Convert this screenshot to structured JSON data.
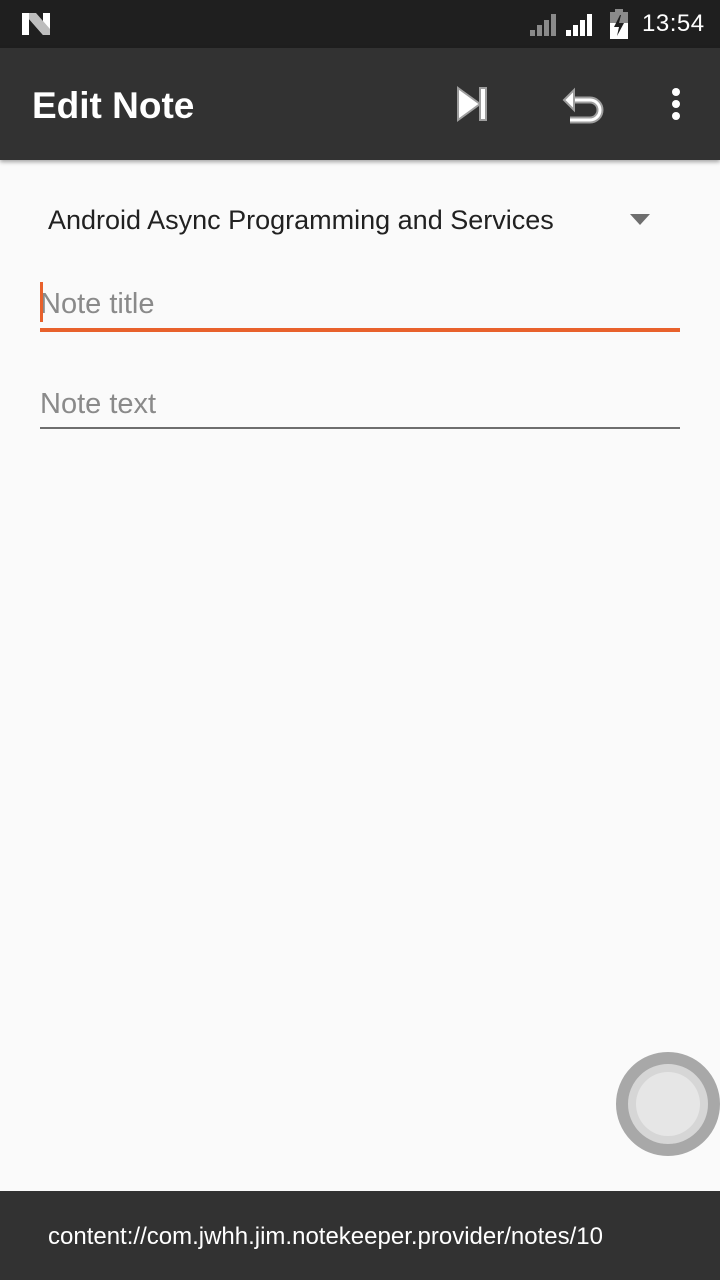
{
  "status_bar": {
    "time": "13:54",
    "icons": [
      "notification-n-icon",
      "signal-icon",
      "signal-icon",
      "battery-charging-icon"
    ]
  },
  "app_bar": {
    "title": "Edit Note",
    "actions": [
      "skip-next-icon",
      "undo-icon",
      "more-vert-icon"
    ]
  },
  "course_spinner": {
    "selected": "Android Async Programming and Services"
  },
  "note_title": {
    "placeholder": "Note title",
    "value": ""
  },
  "note_text": {
    "placeholder": "Note text",
    "value": ""
  },
  "snackbar": {
    "message": "content://com.jwhh.jim.notekeeper.provider/notes/10"
  },
  "colors": {
    "accent": "#e8612c",
    "app_bar": "#323232",
    "status_bar": "#1f1f1f",
    "background": "#fafafa"
  }
}
